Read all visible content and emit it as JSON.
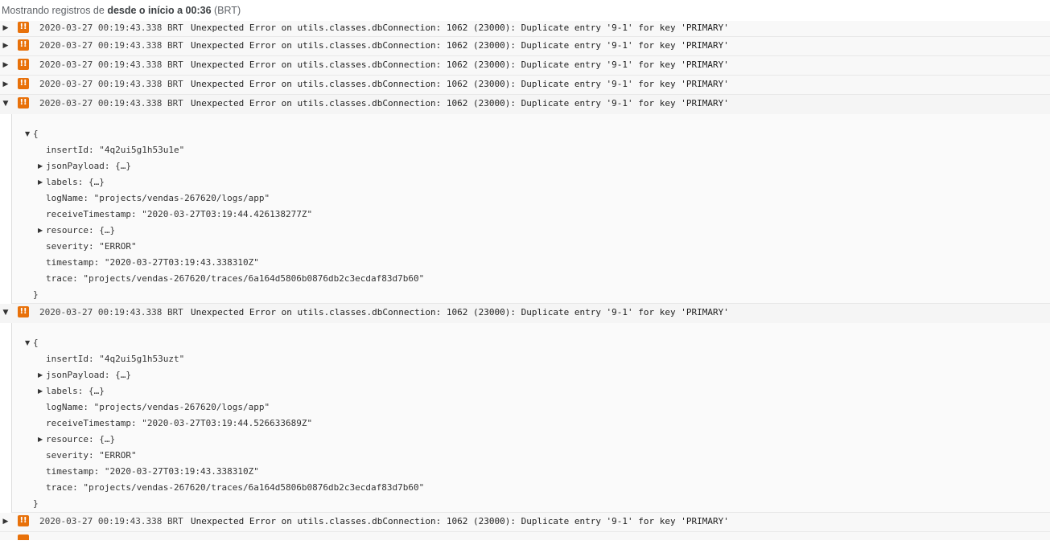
{
  "header": {
    "prefix": "Mostrando registros de ",
    "range": "desde o início a 00:36",
    "suffix": " (BRT)"
  },
  "colors": {
    "severity_error": "#e8710a"
  },
  "icons": {
    "collapsed": "caret-right-icon",
    "expanded": "caret-down-icon",
    "severity": "error-severity-icon"
  },
  "entries": [
    {
      "timestamp": "2020-03-27 00:19:43.338 BRT",
      "message": "Unexpected Error on utils.classes.dbConnection: 1062 (23000): Duplicate entry '9-1' for key 'PRIMARY'",
      "expanded": false
    },
    {
      "timestamp": "2020-03-27 00:19:43.338 BRT",
      "message": "Unexpected Error on utils.classes.dbConnection: 1062 (23000): Duplicate entry '9-1' for key 'PRIMARY'",
      "expanded": false
    },
    {
      "timestamp": "2020-03-27 00:19:43.338 BRT",
      "message": "Unexpected Error on utils.classes.dbConnection: 1062 (23000): Duplicate entry '9-1' for key 'PRIMARY'",
      "expanded": false
    },
    {
      "timestamp": "2020-03-27 00:19:43.338 BRT",
      "message": "Unexpected Error on utils.classes.dbConnection: 1062 (23000): Duplicate entry '9-1' for key 'PRIMARY'",
      "expanded": false
    },
    {
      "timestamp": "2020-03-27 00:19:43.338 BRT",
      "message": "Unexpected Error on utils.classes.dbConnection: 1062 (23000): Duplicate entry '9-1' for key 'PRIMARY'",
      "expanded": true,
      "payload": {
        "open": "{",
        "close": "}",
        "insertId": "insertId: \"4q2ui5g1h53u1e\"",
        "jsonPayload": "jsonPayload: {…}",
        "labels": "labels: {…}",
        "logName": "logName: \"projects/vendas-267620/logs/app\"",
        "receiveTimestamp": "receiveTimestamp: \"2020-03-27T03:19:44.426138277Z\"",
        "resource": "resource: {…}",
        "severity": "severity: \"ERROR\"",
        "timestamp": "timestamp: \"2020-03-27T03:19:43.338310Z\"",
        "trace": "trace: \"projects/vendas-267620/traces/6a164d5806b0876db2c3ecdaf83d7b60\""
      }
    },
    {
      "timestamp": "2020-03-27 00:19:43.338 BRT",
      "message": "Unexpected Error on utils.classes.dbConnection: 1062 (23000): Duplicate entry '9-1' for key 'PRIMARY'",
      "expanded": true,
      "payload": {
        "open": "{",
        "close": "}",
        "insertId": "insertId: \"4q2ui5g1h53uzt\"",
        "jsonPayload": "jsonPayload: {…}",
        "labels": "labels: {…}",
        "logName": "logName: \"projects/vendas-267620/logs/app\"",
        "receiveTimestamp": "receiveTimestamp: \"2020-03-27T03:19:44.526633689Z\"",
        "resource": "resource: {…}",
        "severity": "severity: \"ERROR\"",
        "timestamp": "timestamp: \"2020-03-27T03:19:43.338310Z\"",
        "trace": "trace: \"projects/vendas-267620/traces/6a164d5806b0876db2c3ecdaf83d7b60\""
      }
    },
    {
      "timestamp": "2020-03-27 00:19:43.338 BRT",
      "message": "Unexpected Error on utils.classes.dbConnection: 1062 (23000): Duplicate entry '9-1' for key 'PRIMARY'",
      "expanded": false
    }
  ]
}
